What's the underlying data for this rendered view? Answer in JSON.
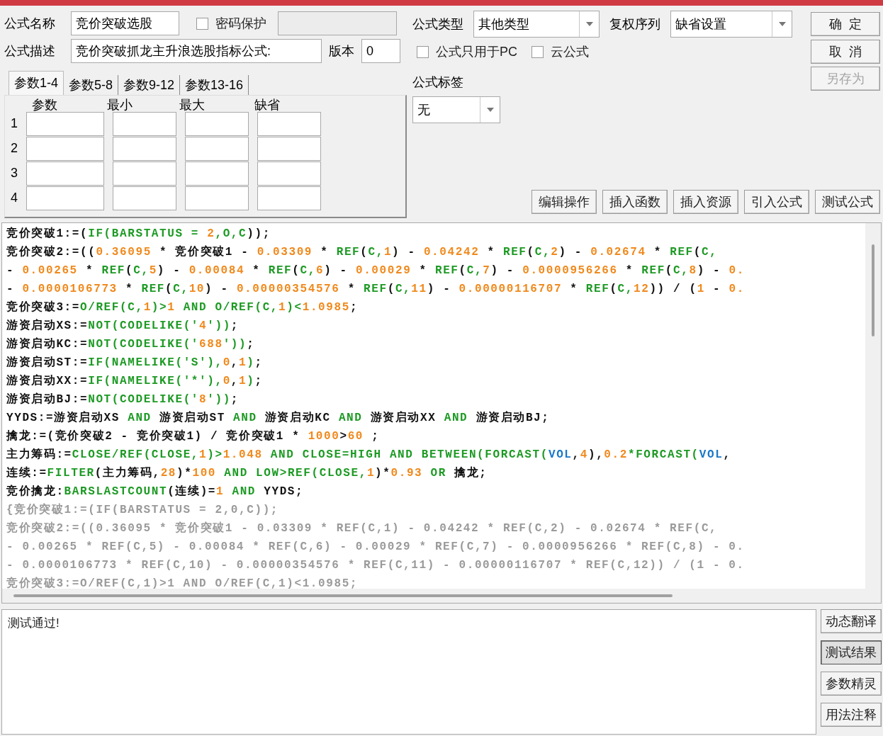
{
  "form": {
    "name_label": "公式名称",
    "name_value": "竞价突破选股",
    "password": {
      "label": "密码保护",
      "checked": false
    },
    "desc_label": "公式描述",
    "desc_value": "竞价突破抓龙主升浪选股指标公式:",
    "version_label": "版本",
    "version_value": "0",
    "type_label": "公式类型",
    "type_value": "其他类型",
    "rights_label": "复权序列",
    "rights_value": "缺省设置",
    "options": [
      {
        "label": "公式只用于PC",
        "checked": false
      },
      {
        "label": "云公式",
        "checked": false
      }
    ],
    "tag_label": "公式标签",
    "tag_value": "无"
  },
  "dialog_buttons": [
    {
      "label": "确  定",
      "disabled": false
    },
    {
      "label": "取  消",
      "disabled": false
    },
    {
      "label": "另存为",
      "disabled": true
    }
  ],
  "param_tabs": [
    {
      "label": "参数1-4",
      "selected": true
    },
    {
      "label": "参数5-8",
      "selected": false
    },
    {
      "label": "参数9-12",
      "selected": false
    },
    {
      "label": "参数13-16",
      "selected": false
    }
  ],
  "param_columns": [
    "参数",
    "最小",
    "最大",
    "缺省"
  ],
  "param_rows": [
    "1",
    "2",
    "3",
    "4"
  ],
  "toolbar": [
    "编辑操作",
    "插入函数",
    "插入资源",
    "引入公式",
    "测试公式"
  ],
  "editor_lines": [
    {
      "kind": "code",
      "tokens": [
        {
          "kind": "plain",
          "text": "竞价突破1:=("
        },
        {
          "kind": "func",
          "text": "IF(BARSTATUS = "
        },
        {
          "kind": "num",
          "text": "2"
        },
        {
          "kind": "func",
          "text": ",O,C"
        },
        {
          "kind": "plain",
          "text": "));"
        }
      ]
    },
    {
      "kind": "code",
      "tokens": [
        {
          "kind": "plain",
          "text": "竞价突破2:=(("
        },
        {
          "kind": "num",
          "text": "0.36095"
        },
        {
          "kind": "plain",
          "text": " * 竞价突破1 - "
        },
        {
          "kind": "num",
          "text": "0.03309"
        },
        {
          "kind": "plain",
          "text": " * "
        },
        {
          "kind": "func",
          "text": "REF"
        },
        {
          "kind": "plain",
          "text": "("
        },
        {
          "kind": "func",
          "text": "C,"
        },
        {
          "kind": "num",
          "text": "1"
        },
        {
          "kind": "plain",
          "text": ") - "
        },
        {
          "kind": "num",
          "text": "0.04242"
        },
        {
          "kind": "plain",
          "text": " * "
        },
        {
          "kind": "func",
          "text": "REF"
        },
        {
          "kind": "plain",
          "text": "("
        },
        {
          "kind": "func",
          "text": "C,"
        },
        {
          "kind": "num",
          "text": "2"
        },
        {
          "kind": "plain",
          "text": ") - "
        },
        {
          "kind": "num",
          "text": "0.02674"
        },
        {
          "kind": "plain",
          "text": " * "
        },
        {
          "kind": "func",
          "text": "REF"
        },
        {
          "kind": "plain",
          "text": "("
        },
        {
          "kind": "func",
          "text": "C,"
        }
      ]
    },
    {
      "kind": "code",
      "tokens": [
        {
          "kind": "plain",
          "text": "- "
        },
        {
          "kind": "num",
          "text": "0.00265"
        },
        {
          "kind": "plain",
          "text": " * "
        },
        {
          "kind": "func",
          "text": "REF"
        },
        {
          "kind": "plain",
          "text": "("
        },
        {
          "kind": "func",
          "text": "C,"
        },
        {
          "kind": "num",
          "text": "5"
        },
        {
          "kind": "plain",
          "text": ") - "
        },
        {
          "kind": "num",
          "text": "0.00084"
        },
        {
          "kind": "plain",
          "text": " * "
        },
        {
          "kind": "func",
          "text": "REF"
        },
        {
          "kind": "plain",
          "text": "("
        },
        {
          "kind": "func",
          "text": "C,"
        },
        {
          "kind": "num",
          "text": "6"
        },
        {
          "kind": "plain",
          "text": ") - "
        },
        {
          "kind": "num",
          "text": "0.00029"
        },
        {
          "kind": "plain",
          "text": " * "
        },
        {
          "kind": "func",
          "text": "REF"
        },
        {
          "kind": "plain",
          "text": "("
        },
        {
          "kind": "func",
          "text": "C,"
        },
        {
          "kind": "num",
          "text": "7"
        },
        {
          "kind": "plain",
          "text": ") - "
        },
        {
          "kind": "num",
          "text": "0.0000956266"
        },
        {
          "kind": "plain",
          "text": " * "
        },
        {
          "kind": "func",
          "text": "REF"
        },
        {
          "kind": "plain",
          "text": "("
        },
        {
          "kind": "func",
          "text": "C,"
        },
        {
          "kind": "num",
          "text": "8"
        },
        {
          "kind": "plain",
          "text": ") - "
        },
        {
          "kind": "num",
          "text": "0."
        }
      ]
    },
    {
      "kind": "code",
      "tokens": [
        {
          "kind": "plain",
          "text": "- "
        },
        {
          "kind": "num",
          "text": "0.0000106773"
        },
        {
          "kind": "plain",
          "text": " * "
        },
        {
          "kind": "func",
          "text": "REF"
        },
        {
          "kind": "plain",
          "text": "("
        },
        {
          "kind": "func",
          "text": "C,"
        },
        {
          "kind": "num",
          "text": "10"
        },
        {
          "kind": "plain",
          "text": ") - "
        },
        {
          "kind": "num",
          "text": "0.00000354576"
        },
        {
          "kind": "plain",
          "text": " * "
        },
        {
          "kind": "func",
          "text": "REF"
        },
        {
          "kind": "plain",
          "text": "("
        },
        {
          "kind": "func",
          "text": "C,"
        },
        {
          "kind": "num",
          "text": "11"
        },
        {
          "kind": "plain",
          "text": ") - "
        },
        {
          "kind": "num",
          "text": "0.00000116707"
        },
        {
          "kind": "plain",
          "text": " * "
        },
        {
          "kind": "func",
          "text": "REF"
        },
        {
          "kind": "plain",
          "text": "("
        },
        {
          "kind": "func",
          "text": "C,"
        },
        {
          "kind": "num",
          "text": "12"
        },
        {
          "kind": "plain",
          "text": ")) / ("
        },
        {
          "kind": "num",
          "text": "1"
        },
        {
          "kind": "plain",
          "text": " - "
        },
        {
          "kind": "num",
          "text": "0."
        }
      ]
    },
    {
      "kind": "code",
      "tokens": [
        {
          "kind": "plain",
          "text": "竞价突破3:="
        },
        {
          "kind": "func",
          "text": "O/REF(C,"
        },
        {
          "kind": "num",
          "text": "1"
        },
        {
          "kind": "func",
          "text": ")>"
        },
        {
          "kind": "num",
          "text": "1"
        },
        {
          "kind": "func",
          "text": " AND O/REF(C,"
        },
        {
          "kind": "num",
          "text": "1"
        },
        {
          "kind": "func",
          "text": ")<"
        },
        {
          "kind": "num",
          "text": "1.0985"
        },
        {
          "kind": "plain",
          "text": ";"
        }
      ]
    },
    {
      "kind": "code",
      "tokens": [
        {
          "kind": "plain",
          "text": "游资启动XS:="
        },
        {
          "kind": "func",
          "text": "NOT(CODELIKE('"
        },
        {
          "kind": "num",
          "text": "4"
        },
        {
          "kind": "func",
          "text": "'))"
        },
        {
          "kind": "plain",
          "text": ";"
        }
      ]
    },
    {
      "kind": "code",
      "tokens": [
        {
          "kind": "plain",
          "text": "游资启动KC:="
        },
        {
          "kind": "func",
          "text": "NOT(CODELIKE('"
        },
        {
          "kind": "num",
          "text": "688"
        },
        {
          "kind": "func",
          "text": "'))"
        },
        {
          "kind": "plain",
          "text": ";"
        }
      ]
    },
    {
      "kind": "code",
      "tokens": [
        {
          "kind": "plain",
          "text": "游资启动ST:="
        },
        {
          "kind": "func",
          "text": "IF(NAMELIKE('S'),"
        },
        {
          "kind": "num",
          "text": "0"
        },
        {
          "kind": "plain",
          "text": ","
        },
        {
          "kind": "num",
          "text": "1"
        },
        {
          "kind": "func",
          "text": ")"
        },
        {
          "kind": "plain",
          "text": ";"
        }
      ]
    },
    {
      "kind": "code",
      "tokens": [
        {
          "kind": "plain",
          "text": "游资启动XX:="
        },
        {
          "kind": "func",
          "text": "IF(NAMELIKE('*'),"
        },
        {
          "kind": "num",
          "text": "0"
        },
        {
          "kind": "plain",
          "text": ","
        },
        {
          "kind": "num",
          "text": "1"
        },
        {
          "kind": "func",
          "text": ")"
        },
        {
          "kind": "plain",
          "text": ";"
        }
      ]
    },
    {
      "kind": "code",
      "tokens": [
        {
          "kind": "plain",
          "text": "游资启动BJ:="
        },
        {
          "kind": "func",
          "text": "NOT(CODELIKE('"
        },
        {
          "kind": "num",
          "text": "8"
        },
        {
          "kind": "func",
          "text": "'))"
        },
        {
          "kind": "plain",
          "text": ";"
        }
      ]
    },
    {
      "kind": "code",
      "tokens": [
        {
          "kind": "plain",
          "text": "YYDS:=游资启动XS "
        },
        {
          "kind": "func",
          "text": "AND"
        },
        {
          "kind": "plain",
          "text": " 游资启动ST "
        },
        {
          "kind": "func",
          "text": "AND"
        },
        {
          "kind": "plain",
          "text": " 游资启动KC "
        },
        {
          "kind": "func",
          "text": "AND"
        },
        {
          "kind": "plain",
          "text": " 游资启动XX "
        },
        {
          "kind": "func",
          "text": "AND"
        },
        {
          "kind": "plain",
          "text": " 游资启动BJ;"
        }
      ]
    },
    {
      "kind": "code",
      "tokens": [
        {
          "kind": "plain",
          "text": "擒龙:=(竞价突破2 - 竞价突破1) / 竞价突破1 * "
        },
        {
          "kind": "num",
          "text": "1000"
        },
        {
          "kind": "plain",
          "text": ">"
        },
        {
          "kind": "num",
          "text": "60"
        },
        {
          "kind": "plain",
          "text": " ;"
        }
      ]
    },
    {
      "kind": "code",
      "tokens": [
        {
          "kind": "plain",
          "text": "主力筹码:="
        },
        {
          "kind": "func",
          "text": "CLOSE/REF(CLOSE,"
        },
        {
          "kind": "num",
          "text": "1"
        },
        {
          "kind": "func",
          "text": ")>"
        },
        {
          "kind": "num",
          "text": "1.048"
        },
        {
          "kind": "func",
          "text": " AND CLOSE=HIGH AND BETWEEN(FORCAST("
        },
        {
          "kind": "var",
          "text": "VOL"
        },
        {
          "kind": "plain",
          "text": ","
        },
        {
          "kind": "num",
          "text": "4"
        },
        {
          "kind": "plain",
          "text": "),"
        },
        {
          "kind": "num",
          "text": "0.2"
        },
        {
          "kind": "func",
          "text": "*FORCAST("
        },
        {
          "kind": "var",
          "text": "VOL"
        },
        {
          "kind": "plain",
          "text": ","
        }
      ]
    },
    {
      "kind": "code",
      "tokens": [
        {
          "kind": "plain",
          "text": "连续:="
        },
        {
          "kind": "func",
          "text": "FILTER"
        },
        {
          "kind": "plain",
          "text": "(主力筹码,"
        },
        {
          "kind": "num",
          "text": "28"
        },
        {
          "kind": "plain",
          "text": ")*"
        },
        {
          "kind": "num",
          "text": "100"
        },
        {
          "kind": "func",
          "text": " AND LOW>REF(CLOSE,"
        },
        {
          "kind": "num",
          "text": "1"
        },
        {
          "kind": "plain",
          "text": ")*"
        },
        {
          "kind": "num",
          "text": "0.93"
        },
        {
          "kind": "func",
          "text": " OR"
        },
        {
          "kind": "plain",
          "text": " 擒龙;"
        }
      ]
    },
    {
      "kind": "code",
      "tokens": [
        {
          "kind": "plain",
          "text": "竞价擒龙:"
        },
        {
          "kind": "func",
          "text": "BARSLASTCOUNT"
        },
        {
          "kind": "plain",
          "text": "(连续)="
        },
        {
          "kind": "num",
          "text": "1"
        },
        {
          "kind": "func",
          "text": " AND"
        },
        {
          "kind": "plain",
          "text": " YYDS;"
        }
      ]
    },
    {
      "kind": "comment",
      "text": "{竞价突破1:=(IF(BARSTATUS = 2,0,C));"
    },
    {
      "kind": "comment",
      "text": "竞价突破2:=((0.36095 * 竞价突破1 - 0.03309 * REF(C,1) - 0.04242 * REF(C,2) - 0.02674 * REF(C,"
    },
    {
      "kind": "comment",
      "text": "- 0.00265 * REF(C,5) - 0.00084 * REF(C,6) - 0.00029 * REF(C,7) - 0.0000956266 * REF(C,8) - 0."
    },
    {
      "kind": "comment",
      "text": "- 0.0000106773 * REF(C,10) - 0.00000354576 * REF(C,11) - 0.00000116707 * REF(C,12)) / (1 - 0."
    },
    {
      "kind": "comment",
      "text": "竞价突破3:=O/REF(C,1)>1 AND O/REF(C,1)<1.0985;"
    }
  ],
  "output": {
    "text": "测试通过!"
  },
  "side_buttons": [
    {
      "label": "动态翻译",
      "selected": false
    },
    {
      "label": "测试结果",
      "selected": true
    },
    {
      "label": "参数精灵",
      "selected": false
    },
    {
      "label": "用法注释",
      "selected": false
    }
  ]
}
